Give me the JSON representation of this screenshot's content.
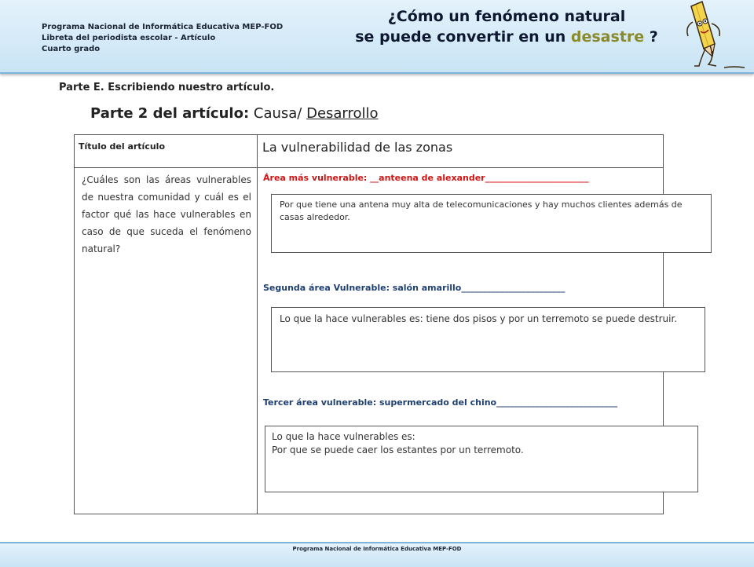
{
  "header": {
    "program_line1": "Programa Nacional de Informática Educativa MEP-FOD",
    "program_line2": "Libreta del periodista escolar -  Artículo",
    "program_line3": "Cuarto grado",
    "title_line1": "¿Cómo un fenómeno natural",
    "title_line2_pre": "se puede convertir en un ",
    "title_line2_accent": "desastre",
    "title_line2_post": " ?"
  },
  "section": {
    "part_e": "Parte E. Escribiendo nuestro artículo.",
    "part2_bold": "Parte 2 del artículo:",
    "part2_mid": " Causa/ ",
    "part2_underlined": "Desarrollo"
  },
  "table": {
    "title_label": "Título del artículo",
    "title_value": "La vulnerabilidad de las zonas",
    "question": "¿Cuáles son las áreas vulnerables de nuestra comunidad y cuál es el factor qué las hace vulnerables en caso de que suceda el fenómeno natural?",
    "area1_label": "Área más vulnerable: __anteena de alexander________________________",
    "area1_reason": "Por que tiene una antena muy alta de telecomunicaciones y hay muchos clientes además de casas alrededor.",
    "area2_label": "Segunda área Vulnerable: salón amarillo________________________",
    "area2_reason": "Lo que la hace vulnerables es: tiene dos pisos y por un terremoto se puede destruir.",
    "area3_label": "Tercer área vulnerable: supermercado del chino____________________________",
    "area3_reason_line1": "Lo que la hace vulnerables es:",
    "area3_reason_line2": "Por que se puede caer los estantes por un terremoto."
  },
  "footer": {
    "text": "Programa  Nacional de Informática  Educativa MEP-FOD"
  },
  "icons": {
    "mascot": "pencil-mascot-icon"
  }
}
